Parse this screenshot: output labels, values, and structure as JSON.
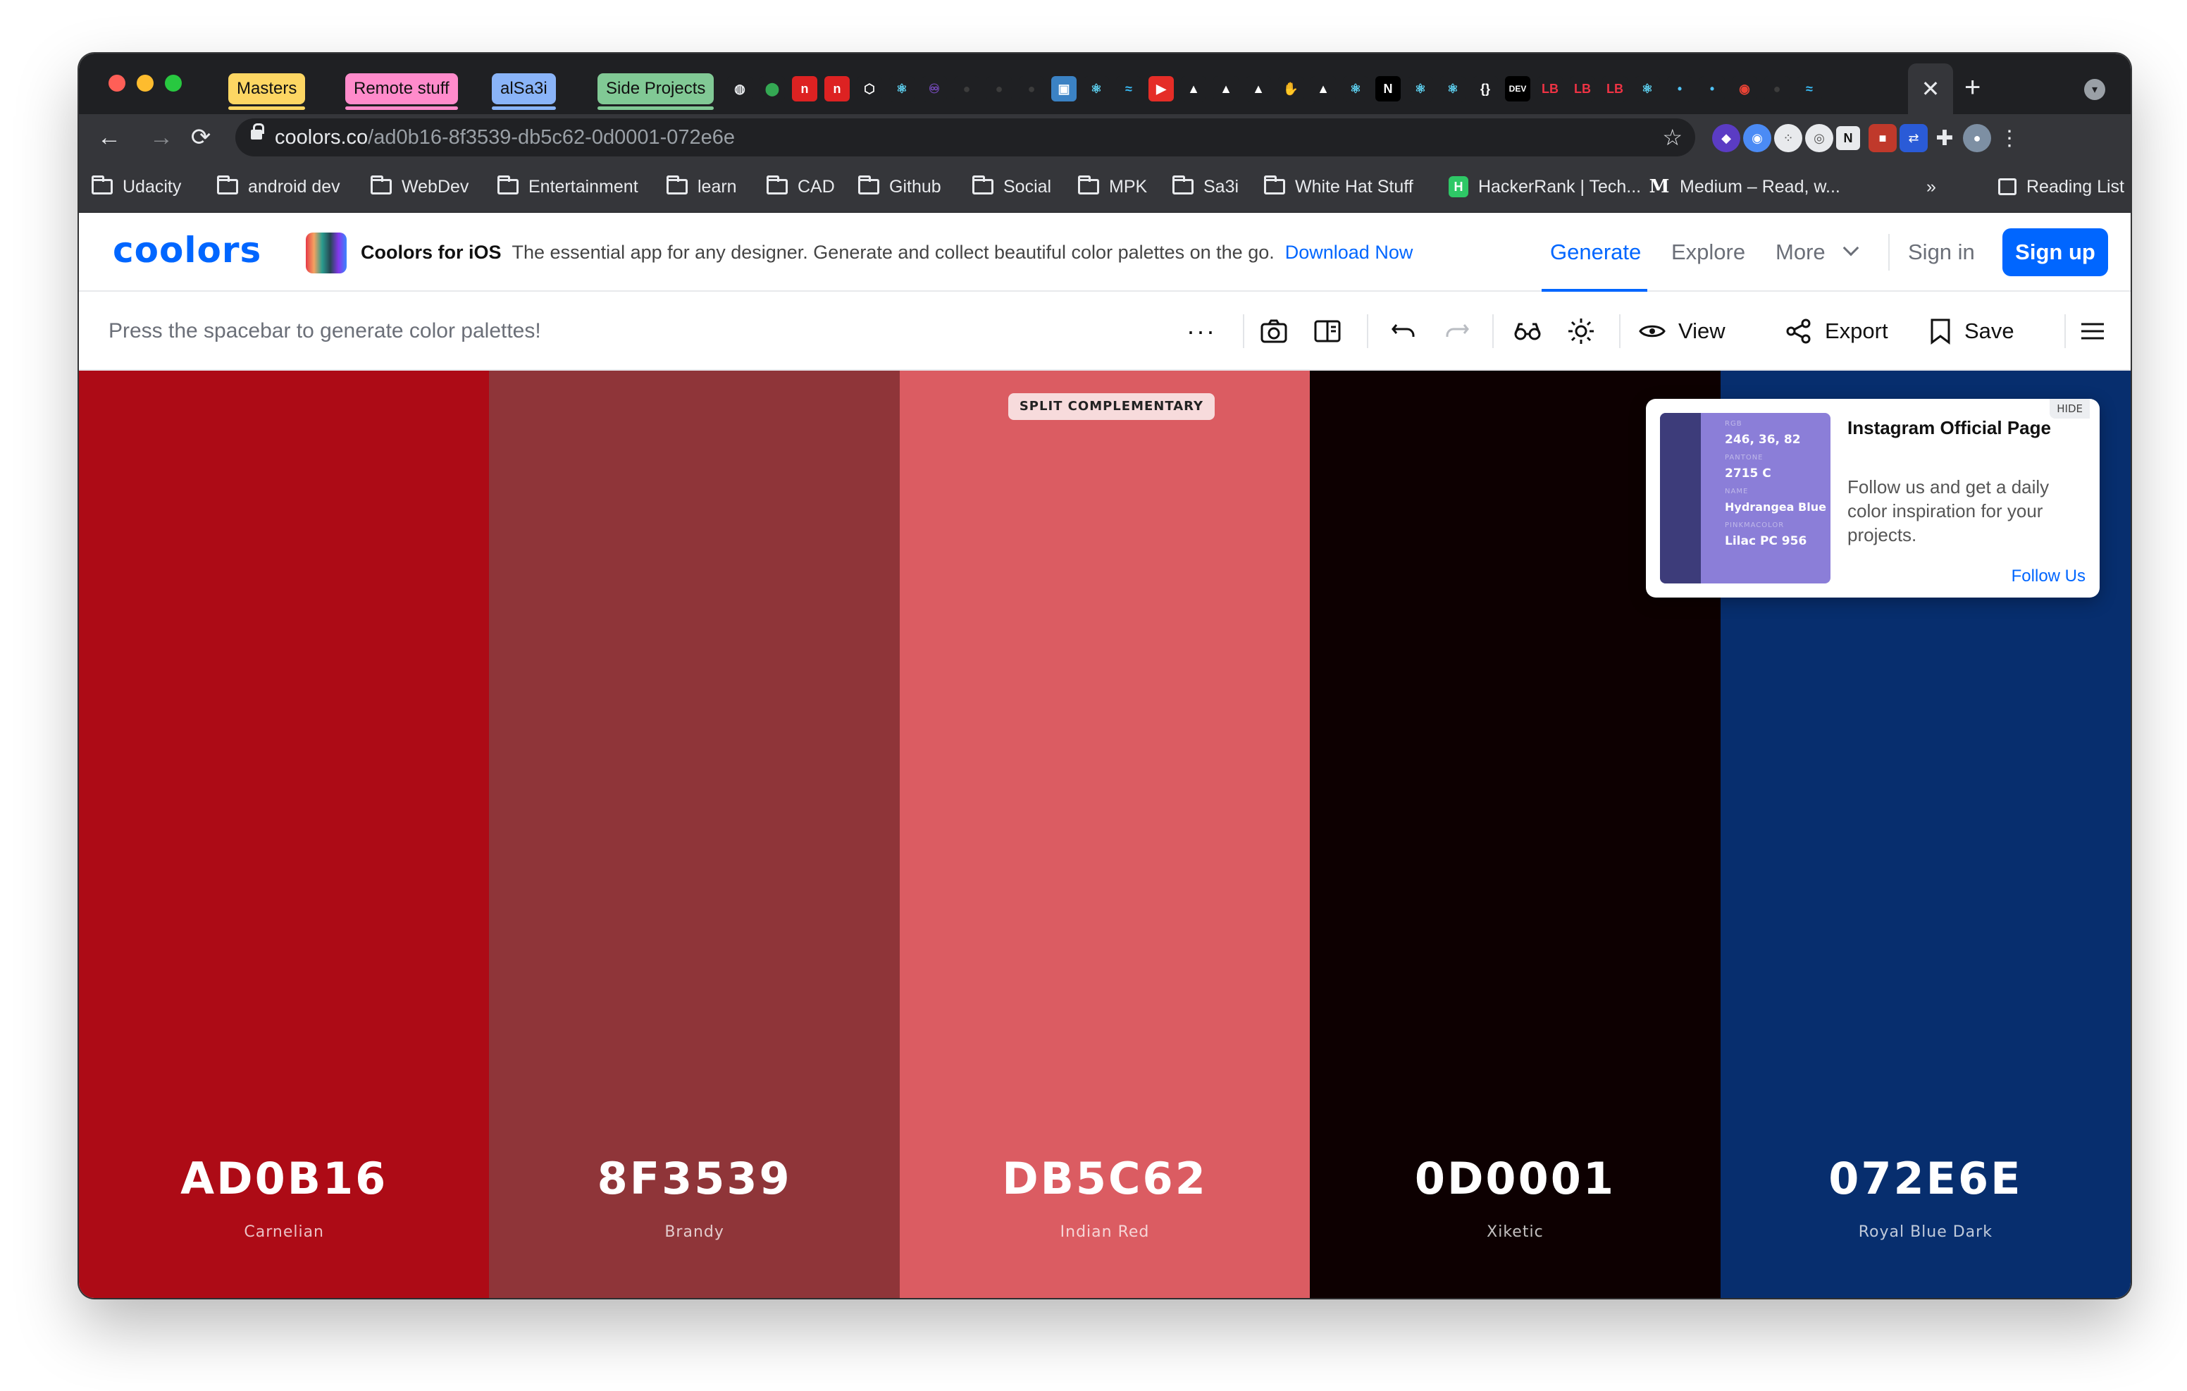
{
  "browser": {
    "tab_groups": [
      {
        "label": "Masters",
        "color": "#fdd663"
      },
      {
        "label": "Remote stuff",
        "color": "#ff8bcb"
      },
      {
        "label": "alSa3i",
        "color": "#8ab4f8"
      },
      {
        "label": "Side Projects",
        "color": "#81c995"
      }
    ],
    "favicons": [
      "globe-icon",
      "maps-icon",
      "n-icon",
      "n-icon",
      "cube-icon",
      "react-icon",
      "redux-icon",
      "github-icon",
      "github-icon",
      "github-icon",
      "site-icon",
      "react-icon",
      "tailwind-icon",
      "youtube-icon",
      "vercel-icon",
      "vercel-icon",
      "vercel-icon",
      "wave-icon",
      "vercel-icon",
      "react-icon",
      "next-icon",
      "react-icon",
      "react-icon",
      "braces-icon",
      "dev-icon",
      "lb-icon",
      "lb-icon",
      "lb-icon",
      "react-icon",
      "dot-icon",
      "dot-icon",
      "record-icon",
      "github-icon",
      "tailwind-icon"
    ],
    "favicon_text": {
      "dev": "DEV",
      "lb": "LB",
      "n": "N",
      "next": "N"
    },
    "active_tab_close": "✕",
    "new_tab": "+",
    "url_host": "coolors.co",
    "url_path": "/ad0b16-8f3539-db5c62-0d0001-072e6e",
    "bookmarks": [
      {
        "label": "Udacity",
        "icon": "folder-icon"
      },
      {
        "label": "android dev",
        "icon": "folder-icon"
      },
      {
        "label": "WebDev",
        "icon": "folder-icon"
      },
      {
        "label": "Entertainment",
        "icon": "folder-icon"
      },
      {
        "label": "learn",
        "icon": "folder-icon"
      },
      {
        "label": "CAD",
        "icon": "folder-icon"
      },
      {
        "label": "Github",
        "icon": "folder-icon"
      },
      {
        "label": "Social",
        "icon": "folder-icon"
      },
      {
        "label": "MPK",
        "icon": "folder-icon"
      },
      {
        "label": "Sa3i",
        "icon": "folder-icon"
      },
      {
        "label": "White Hat Stuff",
        "icon": "folder-icon"
      },
      {
        "label": "HackerRank | Tech...",
        "icon": "hackerrank-icon"
      },
      {
        "label": "Medium – Read, w...",
        "icon": "medium-icon"
      }
    ],
    "bookmarks_overflow": "»",
    "reading_list": "Reading List"
  },
  "header": {
    "logo": "coolors",
    "promo_title": "Coolors for iOS",
    "promo_text": "The essential app for any designer. Generate and collect beautiful color palettes on the go.",
    "promo_link": "Download Now",
    "nav": [
      "Generate",
      "Explore",
      "More"
    ],
    "sign_in": "Sign in",
    "sign_up": "Sign up"
  },
  "toolbar": {
    "hint": "Press the spacebar to generate color palettes!",
    "view": "View",
    "export": "Export",
    "save": "Save"
  },
  "palette": {
    "tag": "SPLIT COMPLEMENTARY",
    "colors": [
      {
        "hex": "AD0B16",
        "name": "Carnelian",
        "color": "#ad0b16"
      },
      {
        "hex": "8F3539",
        "name": "Brandy",
        "color": "#8f3539"
      },
      {
        "hex": "DB5C62",
        "name": "Indian Red",
        "color": "#db5c62"
      },
      {
        "hex": "0D0001",
        "name": "Xiketic",
        "color": "#0d0001"
      },
      {
        "hex": "072E6E",
        "name": "Royal Blue Dark",
        "color": "#072e6e"
      }
    ]
  },
  "instagram_card": {
    "hide": "HIDE",
    "title": "Instagram Official Page",
    "text": "Follow us and get a daily color inspiration for your projects.",
    "follow": "Follow Us",
    "image": {
      "rgb_label": "RGB",
      "rgb": "246, 36, 82",
      "pantone_label": "PANTONE",
      "pantone": "2715 C",
      "name_label": "NAME",
      "name": "Hydrangea Blue",
      "pm_label": "PINKMACOLOR",
      "pm": "Lilac PC 956"
    }
  }
}
